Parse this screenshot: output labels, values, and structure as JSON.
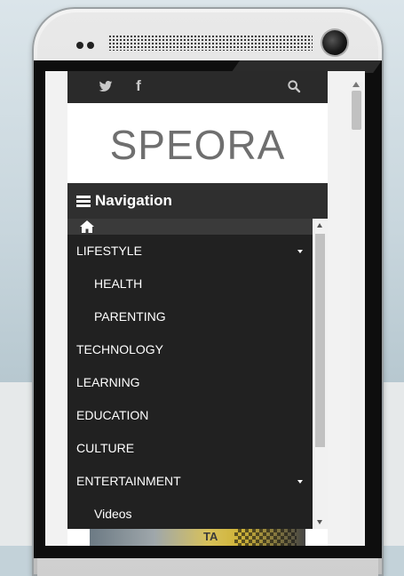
{
  "topbar": {
    "icons": [
      "twitter-icon",
      "facebook-icon",
      "search-icon"
    ],
    "facebook_glyph": "f"
  },
  "brand": {
    "logo": "SPEORA"
  },
  "nav": {
    "title": "Navigation"
  },
  "menu": {
    "items": [
      {
        "label": "LIFESTYLE",
        "submenu": true
      },
      {
        "label": "HEALTH",
        "level": 2
      },
      {
        "label": "PARENTING",
        "level": 2
      },
      {
        "label": "TECHNOLOGY"
      },
      {
        "label": "LEARNING"
      },
      {
        "label": "EDUCATION"
      },
      {
        "label": "CULTURE"
      },
      {
        "label": "ENTERTAINMENT",
        "submenu": true
      },
      {
        "label": "Videos",
        "level": 2
      }
    ]
  },
  "teaser": {
    "text": "TA"
  },
  "colors": {
    "topbar": "#2a2a2a",
    "navbar": "#2f2f2f",
    "menu_bg": "#212121",
    "logo": "#6f6f6f"
  }
}
